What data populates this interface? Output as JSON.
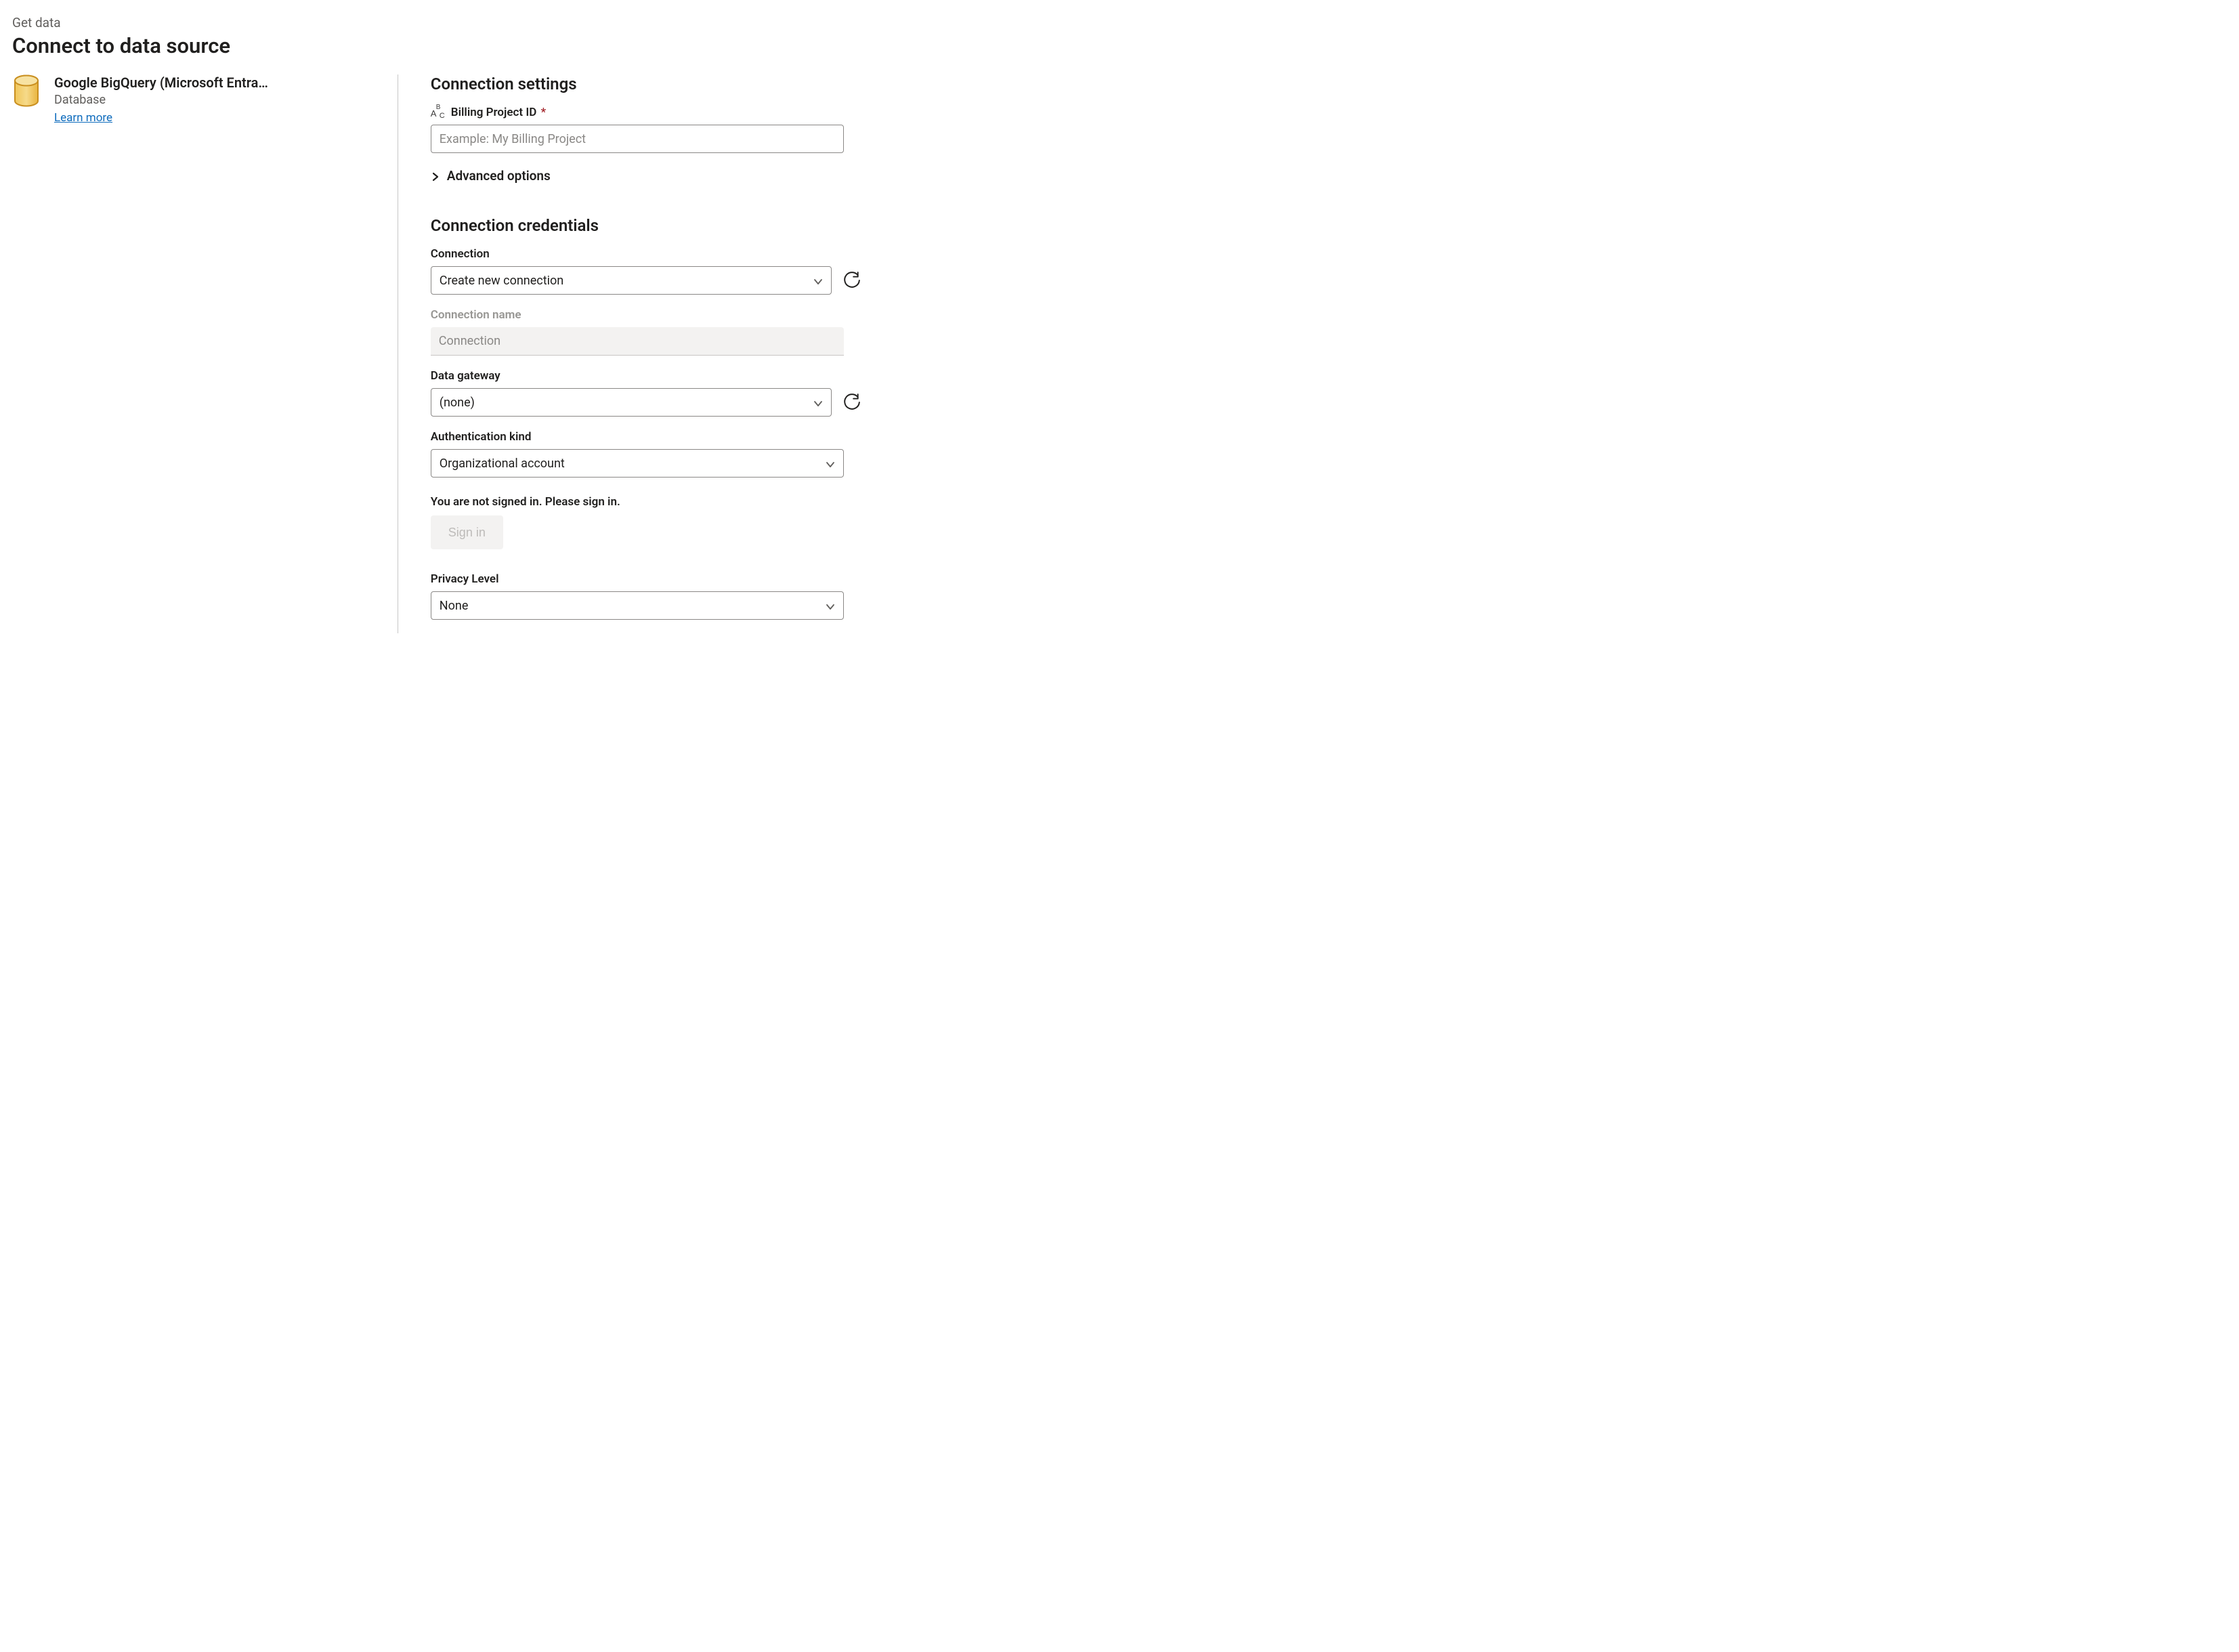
{
  "header": {
    "breadcrumb": "Get data",
    "title": "Connect to data source"
  },
  "connector": {
    "title": "Google BigQuery (Microsoft Entra…",
    "category": "Database",
    "learn_more": "Learn more"
  },
  "settings": {
    "heading": "Connection settings",
    "billing": {
      "label": "Billing Project ID",
      "required_mark": "*",
      "placeholder": "Example: My Billing Project",
      "value": ""
    },
    "advanced_label": "Advanced options"
  },
  "credentials": {
    "heading": "Connection credentials",
    "connection": {
      "label": "Connection",
      "value": "Create new connection"
    },
    "connection_name": {
      "label": "Connection name",
      "placeholder": "Connection",
      "value": ""
    },
    "gateway": {
      "label": "Data gateway",
      "value": "(none)"
    },
    "auth_kind": {
      "label": "Authentication kind",
      "value": "Organizational account"
    },
    "signin_message": "You are not signed in. Please sign in.",
    "signin_button": "Sign in",
    "privacy": {
      "label": "Privacy Level",
      "value": "None"
    }
  }
}
